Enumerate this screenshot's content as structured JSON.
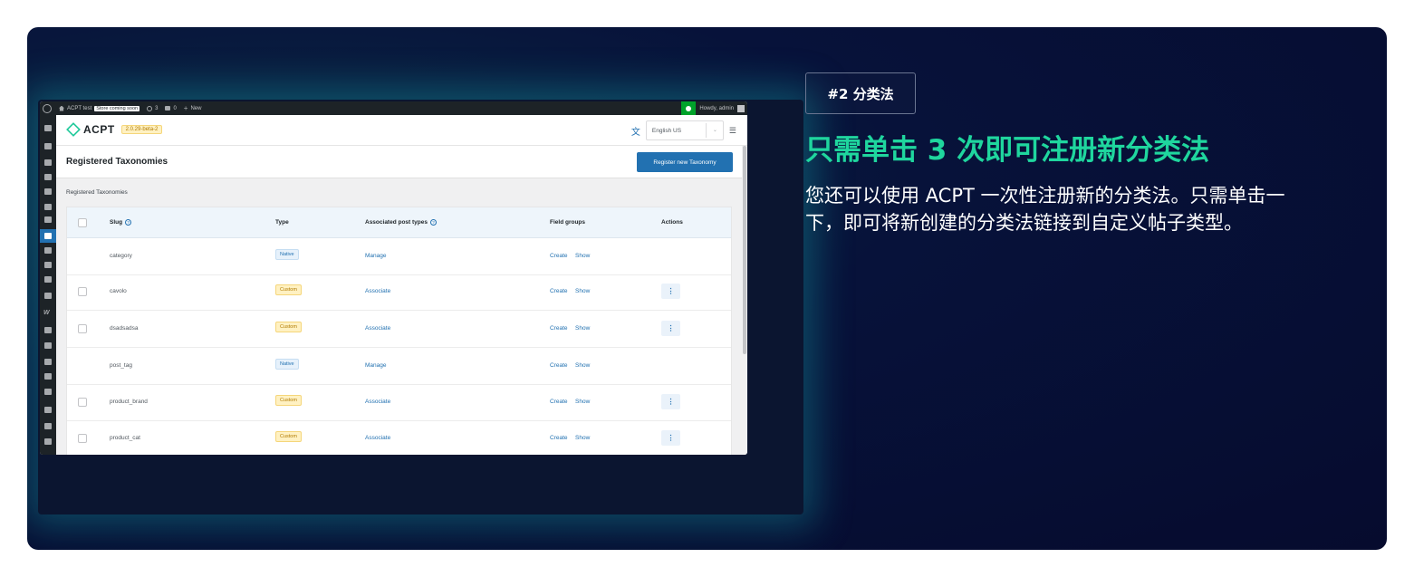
{
  "admin_bar": {
    "site_name": "ACPT test",
    "store_status": "Store coming soon",
    "updates_count": "3",
    "comments_count": "0",
    "new_label": "New",
    "howdy": "Howdy, admin"
  },
  "acpt": {
    "logo": "ACPT",
    "version": "2.0.29-beta-2",
    "language": "English US"
  },
  "page": {
    "title": "Registered Taxonomies",
    "register_button": "Register new Taxonomy",
    "breadcrumb": "Registered Taxonomies"
  },
  "table": {
    "headers": {
      "slug": "Slug",
      "type": "Type",
      "associated": "Associated post types",
      "field_groups": "Field groups",
      "actions": "Actions"
    },
    "rows": [
      {
        "slug": "category",
        "type": "Native",
        "assoc": "Manage",
        "create": "Create",
        "show": "Show",
        "checkbox": false,
        "actions": false
      },
      {
        "slug": "cavolo",
        "type": "Custom",
        "assoc": "Associate",
        "create": "Create",
        "show": "Show",
        "checkbox": true,
        "actions": true
      },
      {
        "slug": "dsadsadsa",
        "type": "Custom",
        "assoc": "Associate",
        "create": "Create",
        "show": "Show",
        "checkbox": true,
        "actions": true
      },
      {
        "slug": "post_tag",
        "type": "Native",
        "assoc": "Manage",
        "create": "Create",
        "show": "Show",
        "checkbox": false,
        "actions": false
      },
      {
        "slug": "product_brand",
        "type": "Custom",
        "assoc": "Associate",
        "create": "Create",
        "show": "Show",
        "checkbox": true,
        "actions": true
      },
      {
        "slug": "product_cat",
        "type": "Custom",
        "assoc": "Associate",
        "create": "Create",
        "show": "Show",
        "checkbox": true,
        "actions": true
      }
    ]
  },
  "promo": {
    "tag": "#2 分类法",
    "headline": "只需单击 3 次即可注册新分类法",
    "description": "您还可以使用 ACPT 一次性注册新的分类法。只需单击一下，即可将新创建的分类法链接到自定义帖子类型。"
  },
  "colors": {
    "accent": "#1fd69e",
    "primary": "#2271b1",
    "background": "#060b2e"
  }
}
